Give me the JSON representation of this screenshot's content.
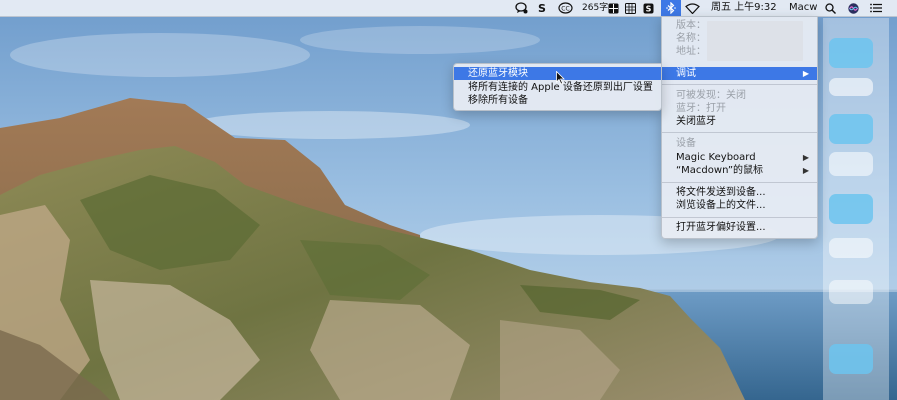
{
  "menubar": {
    "word_count": "265字",
    "clock": "周五 上午9:32",
    "user": "Macw",
    "icons": [
      "chat-icon",
      "s-app-icon",
      "cc-icon",
      "table-icon",
      "grid-icon",
      "s-square-icon",
      "bluetooth-icon",
      "wifi-icon",
      "search-icon",
      "siri-icon",
      "list-icon"
    ]
  },
  "bluetooth_menu": {
    "version_label": "版本：",
    "name_label": "名称：",
    "address_label": "地址：",
    "debug": "调试",
    "discoverable": "可被发现：关闭",
    "bluetooth_status": "蓝牙：打开",
    "turn_off": "关闭蓝牙",
    "devices_header": "设备",
    "devices": [
      "Magic Keyboard",
      "“Macdown”的鼠标"
    ],
    "send_file": "将文件发送到设备...",
    "browse_files": "浏览设备上的文件...",
    "open_prefs": "打开蓝牙偏好设置..."
  },
  "debug_submenu": {
    "items": [
      "还原蓝牙模块",
      "将所有连接的 Apple 设备还原到出厂设置",
      "移除所有设备"
    ]
  },
  "colors": {
    "highlight": "#3d78e6",
    "sky": "#8fb6dc",
    "sea": "#4a7ea8"
  }
}
